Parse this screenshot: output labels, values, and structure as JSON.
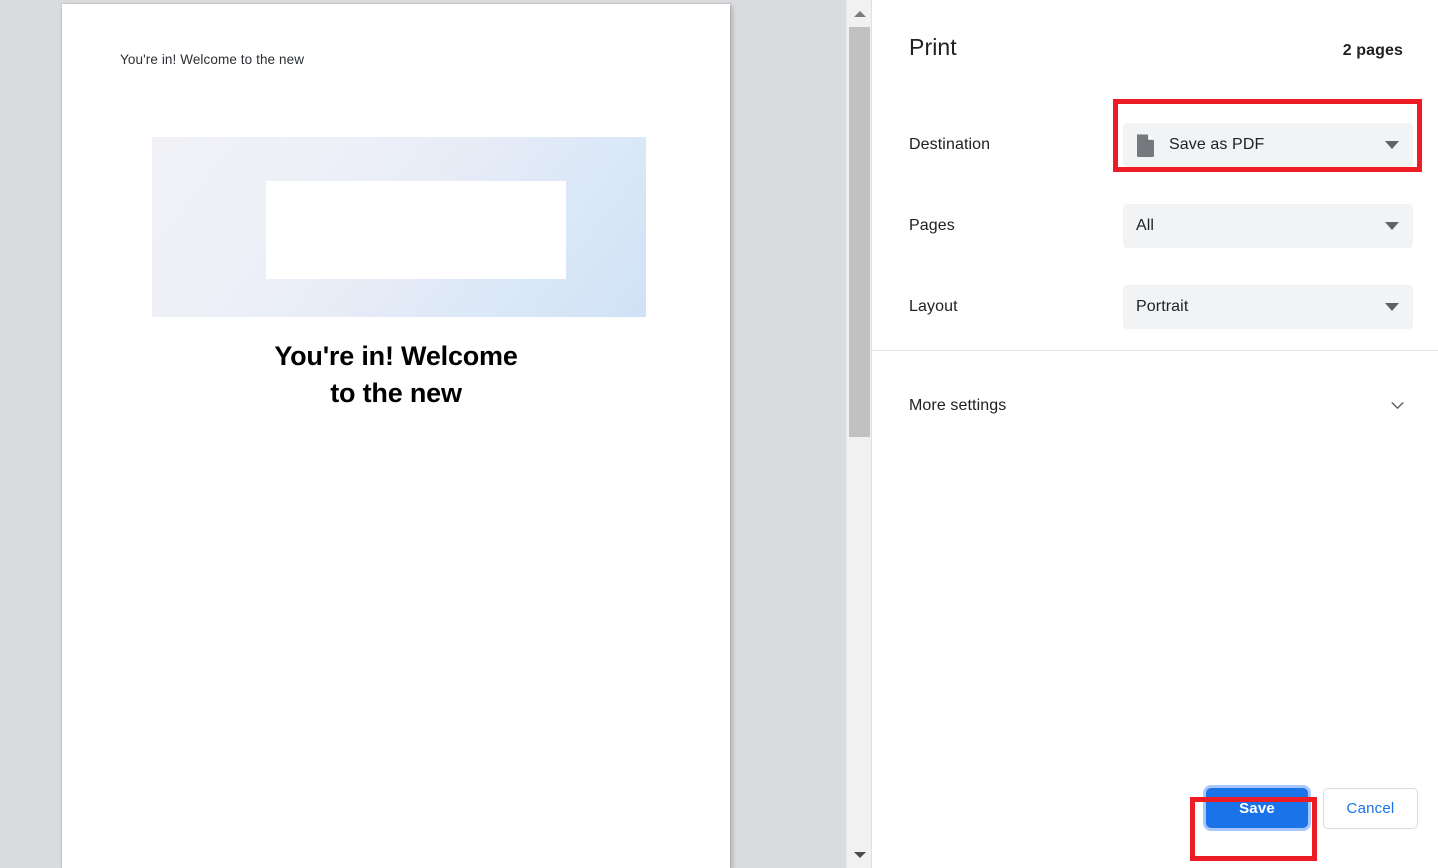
{
  "preview": {
    "top_line": "You're in! Welcome to the new",
    "headline_line1": "You're in! Welcome",
    "headline_line2": "to the new",
    "banner_gradient_from": "#f1f1f6",
    "banner_gradient_to": "#cfe2f6"
  },
  "scrollbar": {
    "up_arrow": "scroll-up-arrow",
    "down_arrow": "scroll-down-arrow"
  },
  "panel": {
    "title": "Print",
    "page_count": "2 pages",
    "settings": [
      {
        "label": "Destination",
        "value": "Save as PDF",
        "icon": "document-icon",
        "has_icon": true
      },
      {
        "label": "Pages",
        "value": "All",
        "has_icon": false
      },
      {
        "label": "Layout",
        "value": "Portrait",
        "has_icon": false
      }
    ],
    "more_settings_label": "More settings",
    "footer": {
      "save_label": "Save",
      "cancel_label": "Cancel",
      "save_color": "#1a73e8",
      "save_focus_ring": "#a8c7fa",
      "cancel_text_color": "#1a73e8"
    }
  },
  "annotations": {
    "color": "#ee1c24",
    "destination_box": "highlight-destination",
    "save_box": "highlight-save"
  }
}
